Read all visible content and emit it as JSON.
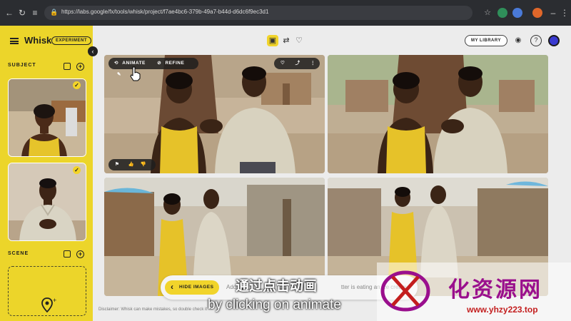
{
  "browser": {
    "url": "https://labs.google/fx/tools/whisk/project/f7ae4bc6-379b-49a7-b44d-d6dc6f9ec3d1"
  },
  "app": {
    "name": "Whisk",
    "badge": "EXPERIMENT"
  },
  "sidebar": {
    "subject_label": "SUBJECT",
    "scene_label": "SCENE"
  },
  "header": {
    "my_library_label": "MY LIBRARY"
  },
  "image_toolbar": {
    "animate_label": "ANIMATE",
    "refine_label": "REFINE"
  },
  "prompt": {
    "hide_images_label": "HIDE IMAGES",
    "placeholder_fragment": "Add a",
    "text_fragment": "tter is eating an ice cream"
  },
  "disclaimer": "Disclaimer: Whisk can make mistakes, so double check it",
  "subtitles": {
    "chinese": "通过点击动画",
    "english": "by clicking on animate"
  },
  "watermark": {
    "brand": "化资源网",
    "url": "www.yhzy223.top"
  },
  "colors": {
    "accent": "#ecd52a",
    "toolbar_dark": "#1e1e1e"
  }
}
